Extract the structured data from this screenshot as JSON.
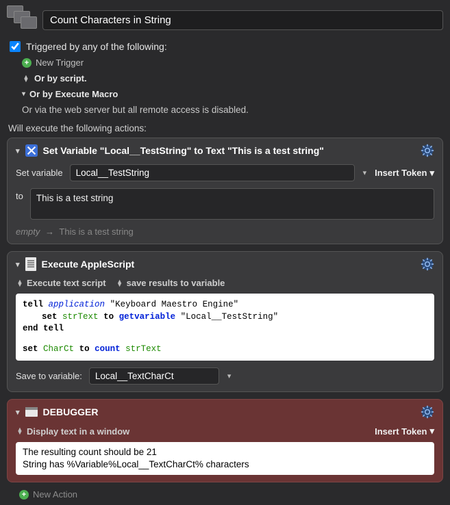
{
  "header": {
    "macro_title": "Count Characters in String"
  },
  "trigger": {
    "checkbox_label": "Triggered by any of the following:",
    "new_trigger": "New Trigger",
    "or_script": "Or by script.",
    "or_execute_macro": "Or by Execute Macro",
    "web_server_note": "Or via the web server but all remote access is disabled."
  },
  "actions_label": "Will execute the following actions:",
  "action1": {
    "title": "Set Variable \"Local__TestString\" to Text \"This is a test string\"",
    "set_variable_label": "Set variable",
    "variable_name": "Local__TestString",
    "insert_token": "Insert Token",
    "to_label": "to",
    "text_value": "This is a test string",
    "preview_empty": "empty",
    "preview_result": "This is a test string"
  },
  "action2": {
    "title": "Execute AppleScript",
    "opt_exec": "Execute text script",
    "opt_save": "save results to variable",
    "script": {
      "l1a": "tell",
      "l1b": "application",
      "l1c": "\"Keyboard Maestro Engine\"",
      "l2a": "set",
      "l2b": "strText",
      "l2c": "to",
      "l2d": "getvariable",
      "l2e": "\"Local__TestString\"",
      "l3": "end tell",
      "l4a": "set",
      "l4b": "CharCt",
      "l4c": "to",
      "l4d": "count",
      "l4e": "strText"
    },
    "save_label": "Save to variable:",
    "save_var": "Local__TextCharCt"
  },
  "action3": {
    "title": "DEBUGGER",
    "display_opt": "Display text in a window",
    "insert_token": "Insert Token",
    "line1": "The resulting count should be 21",
    "line2": "String has %Variable%Local__TextCharCt% characters"
  },
  "new_action": "New Action"
}
